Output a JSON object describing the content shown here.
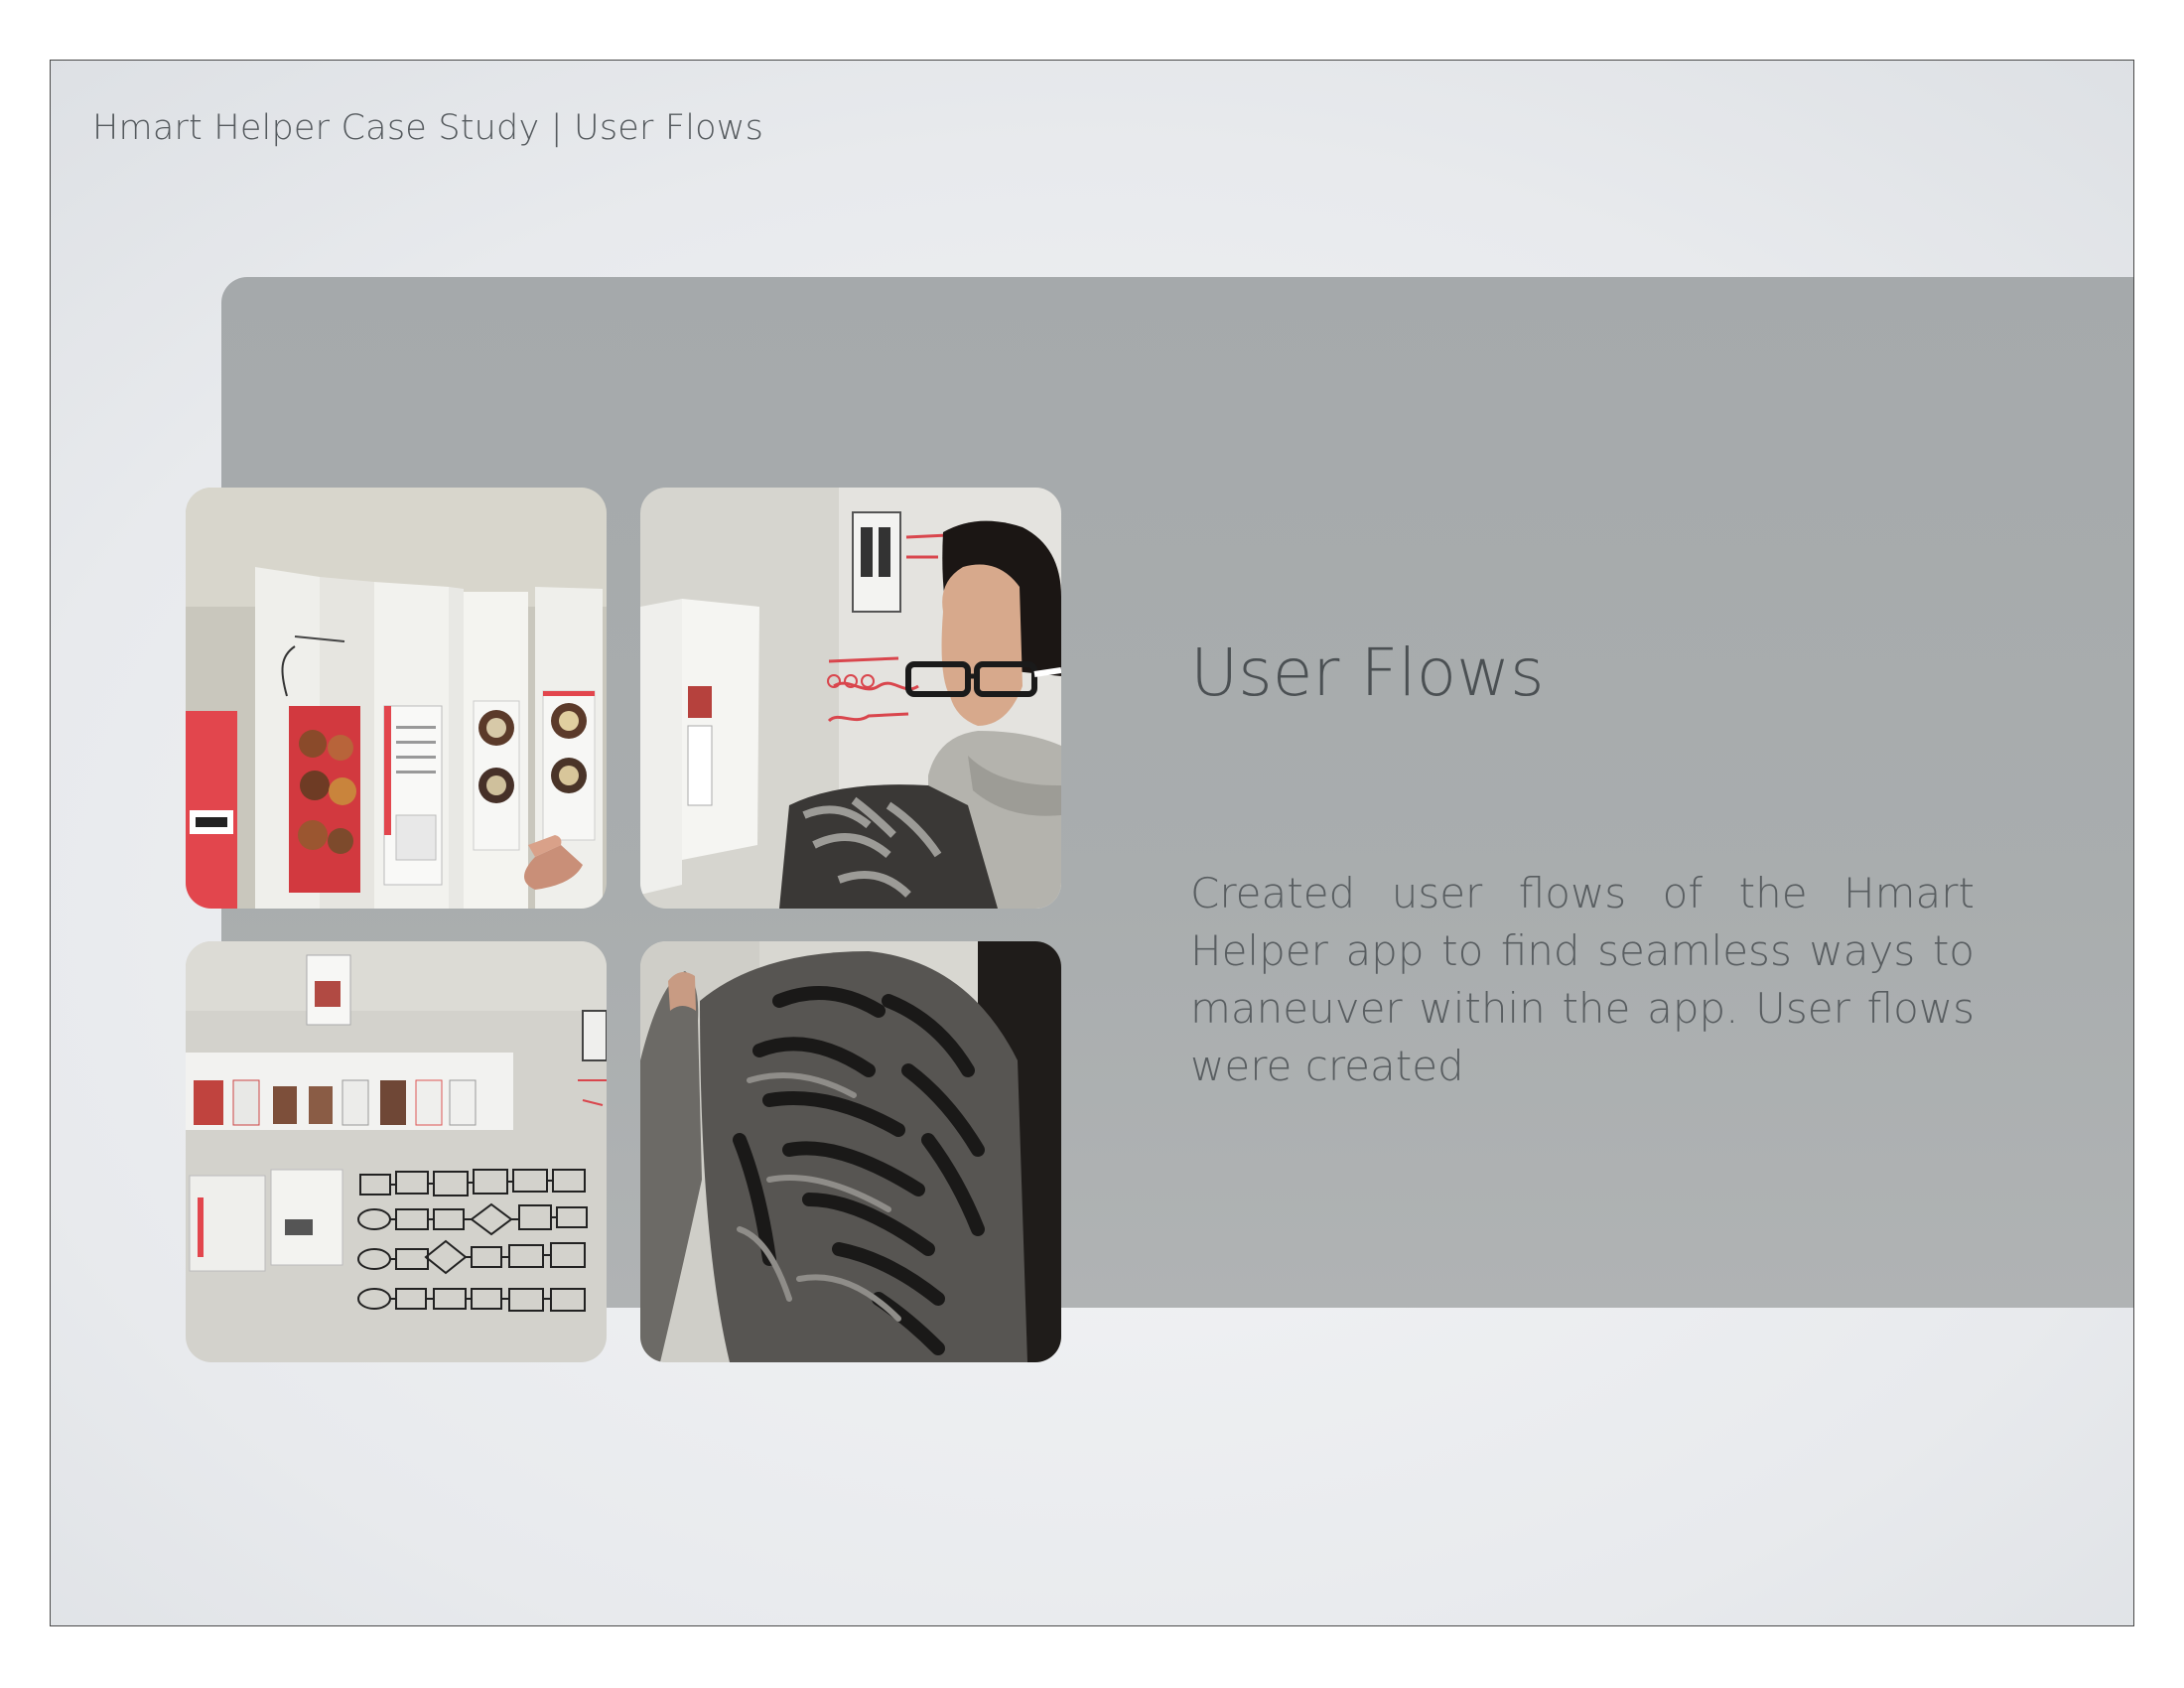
{
  "header": {
    "title": "Hmart Helper Case Study | User Flows"
  },
  "main": {
    "heading": "User Flows",
    "description": "Created user flows of the Hmart Helper app to find seamless ways to maneuver within the app. User flows were created"
  },
  "photos": [
    {
      "icon": "photo-paper-prototypes"
    },
    {
      "icon": "photo-woman-at-whiteboard"
    },
    {
      "icon": "photo-wall-user-flow-diagram"
    },
    {
      "icon": "photo-hand-on-wall"
    }
  ],
  "colors": {
    "panel": "#a7abad",
    "text_dark": "#4b5053",
    "accent_red": "#e0353f"
  }
}
